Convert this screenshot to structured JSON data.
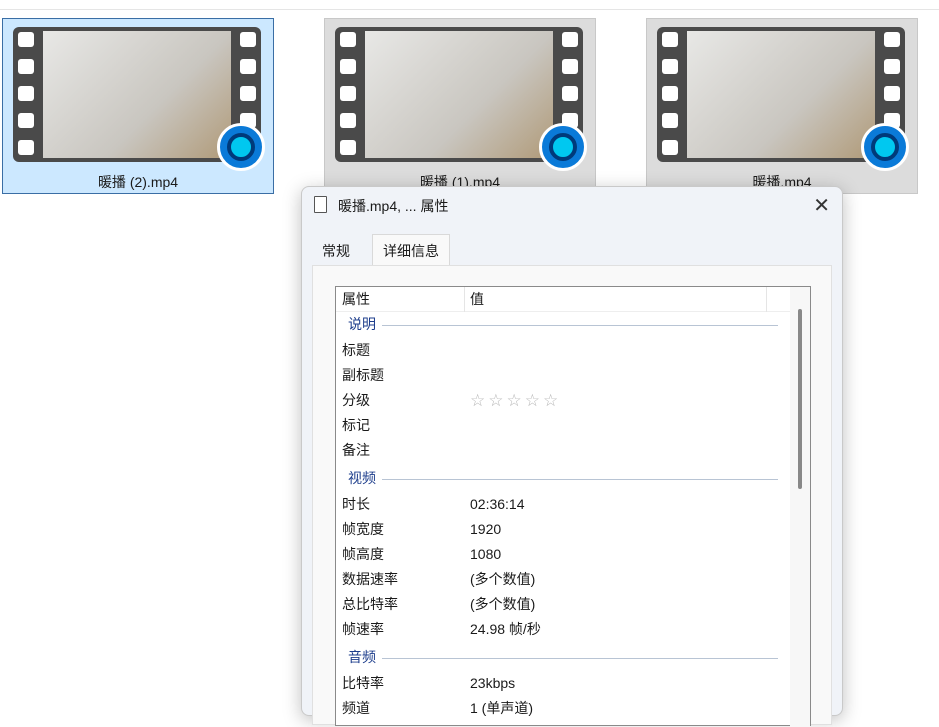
{
  "files": [
    {
      "name": "暖播 (2).mp4",
      "selected": true
    },
    {
      "name": "暖播 (1).mp4",
      "selected": false
    },
    {
      "name": "暖播.mp4",
      "selected": false
    }
  ],
  "dialog": {
    "title": "暖播.mp4, ... 属性",
    "close": "✕",
    "tabs": [
      "常规",
      "详细信息"
    ],
    "header": {
      "prop": "属性",
      "value": "值"
    },
    "groups": {
      "desc": "说明",
      "video": "视频",
      "audio": "音频"
    },
    "desc": [
      {
        "k": "标题",
        "v": ""
      },
      {
        "k": "副标题",
        "v": ""
      },
      {
        "k": "分级",
        "v": "☆☆☆☆☆",
        "rating": 0
      },
      {
        "k": "标记",
        "v": ""
      },
      {
        "k": "备注",
        "v": ""
      }
    ],
    "video": [
      {
        "k": "时长",
        "v": "02:36:14"
      },
      {
        "k": "帧宽度",
        "v": "1920"
      },
      {
        "k": "帧高度",
        "v": "1080"
      },
      {
        "k": "数据速率",
        "v": "(多个数值)"
      },
      {
        "k": "总比特率",
        "v": "(多个数值)"
      },
      {
        "k": "帧速率",
        "v": "24.98 帧/秒"
      }
    ],
    "audio": [
      {
        "k": "比特率",
        "v": "23kbps"
      },
      {
        "k": "频道",
        "v": "1 (单声道)"
      }
    ]
  }
}
